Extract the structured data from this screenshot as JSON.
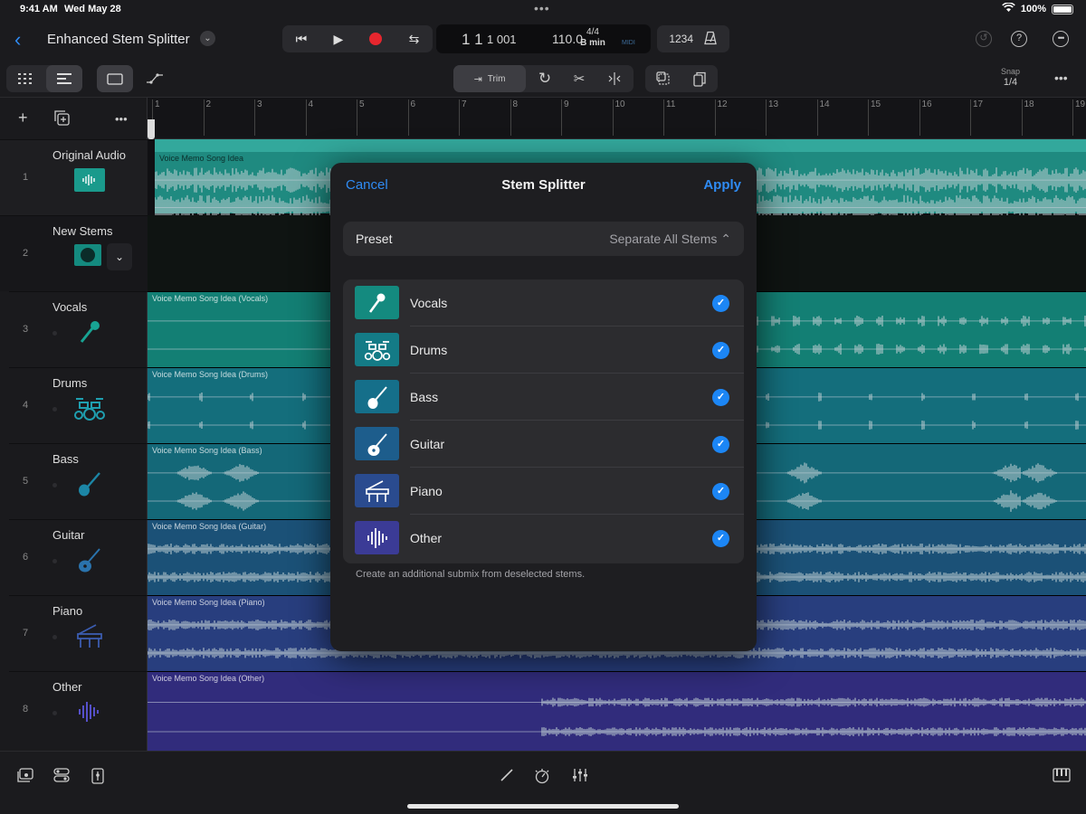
{
  "status": {
    "time": "9:41 AM",
    "date": "Wed May 28",
    "battery": "100%"
  },
  "header": {
    "project_title": "Enhanced Stem Splitter",
    "lcd": {
      "bars": "1 1",
      "position": "1 001",
      "tempo": "110.0",
      "time_signature": "4/4",
      "key": "B min",
      "midi": "MIDI"
    },
    "count_in": "1234"
  },
  "toolbar": {
    "trim_label": "Trim",
    "snap_label": "Snap",
    "snap_value": "1/4"
  },
  "ruler": [
    "1",
    "2",
    "3",
    "4",
    "5",
    "6",
    "7",
    "8",
    "9",
    "10",
    "11",
    "12",
    "13",
    "14",
    "15",
    "16",
    "17",
    "18",
    "19"
  ],
  "tracks": [
    {
      "num": "1",
      "name": "Original Audio"
    },
    {
      "num": "2",
      "name": "New Stems"
    },
    {
      "num": "3",
      "name": "Vocals"
    },
    {
      "num": "4",
      "name": "Drums"
    },
    {
      "num": "5",
      "name": "Bass"
    },
    {
      "num": "6",
      "name": "Guitar"
    },
    {
      "num": "7",
      "name": "Piano"
    },
    {
      "num": "8",
      "name": "Other"
    }
  ],
  "regions": [
    {
      "label": "Voice Memo Song Idea",
      "color": "#1f8a80"
    },
    {
      "label": "Voice Memo Song Idea (Vocals)",
      "color": "#137f74"
    },
    {
      "label": "Voice Memo Song Idea (Drums)",
      "color": "#146e7c"
    },
    {
      "label": "Voice Memo Song Idea (Bass)",
      "color": "#146878"
    },
    {
      "label": "Voice Memo Song Idea (Guitar)",
      "color": "#1b5177"
    },
    {
      "label": "Voice Memo Song Idea (Piano)",
      "color": "#283e7e"
    },
    {
      "label": "Voice Memo Song Idea (Other)",
      "color": "#312c7c"
    }
  ],
  "modal": {
    "cancel": "Cancel",
    "title": "Stem Splitter",
    "apply": "Apply",
    "preset_label": "Preset",
    "preset_value": "Separate All Stems ⌃",
    "stems": [
      {
        "name": "Vocals",
        "color": "#148a7f"
      },
      {
        "name": "Drums",
        "color": "#147b86"
      },
      {
        "name": "Bass",
        "color": "#156f8a"
      },
      {
        "name": "Guitar",
        "color": "#1d5d8c"
      },
      {
        "name": "Piano",
        "color": "#2a4b8f"
      },
      {
        "name": "Other",
        "color": "#3b3b96"
      }
    ],
    "footnote": "Create an additional submix from deselected stems."
  }
}
